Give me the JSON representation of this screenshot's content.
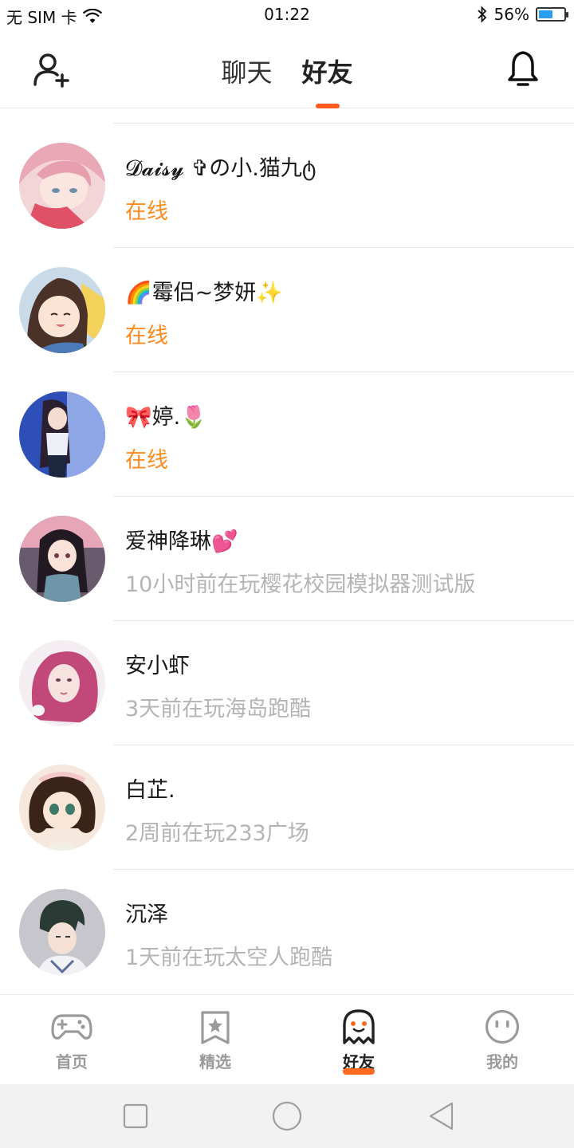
{
  "status_bar": {
    "carrier": "无 SIM 卡",
    "time": "01:22",
    "battery_percent": "56%",
    "battery_level": 0.56
  },
  "header": {
    "tabs": [
      {
        "label": "聊天",
        "active": false
      },
      {
        "label": "好友",
        "active": true
      }
    ],
    "accent_color": "#ff5a1f"
  },
  "friends": [
    {
      "name": "𝓓𝓪𝓲𝓼𝔂 ✞の小.猫九ტ",
      "status": "在线",
      "online": true
    },
    {
      "name": "🌈霉侣~梦妍✨",
      "status": "在线",
      "online": true
    },
    {
      "name": "🎀婷.🌷",
      "status": "在线",
      "online": true
    },
    {
      "name": "爱神降琳💕",
      "status": "10小时前在玩樱花校园模拟器测试版",
      "online": false
    },
    {
      "name": "安小虾",
      "status": "3天前在玩海岛跑酷",
      "online": false
    },
    {
      "name": "白芷.",
      "status": "2周前在玩233广场",
      "online": false
    },
    {
      "name": "沉泽",
      "status": "1天前在玩太空人跑酷",
      "online": false
    }
  ],
  "bottom_nav": {
    "items": [
      {
        "label": "首页",
        "icon": "gamepad-icon",
        "active": false
      },
      {
        "label": "精选",
        "icon": "star-bookmark-icon",
        "active": false
      },
      {
        "label": "好友",
        "icon": "ghost-icon",
        "active": true
      },
      {
        "label": "我的",
        "icon": "face-icon",
        "active": false
      }
    ]
  },
  "colors": {
    "online": "#ff8a1e",
    "offline": "#b4b4b4",
    "accent": "#ff5a1f"
  }
}
